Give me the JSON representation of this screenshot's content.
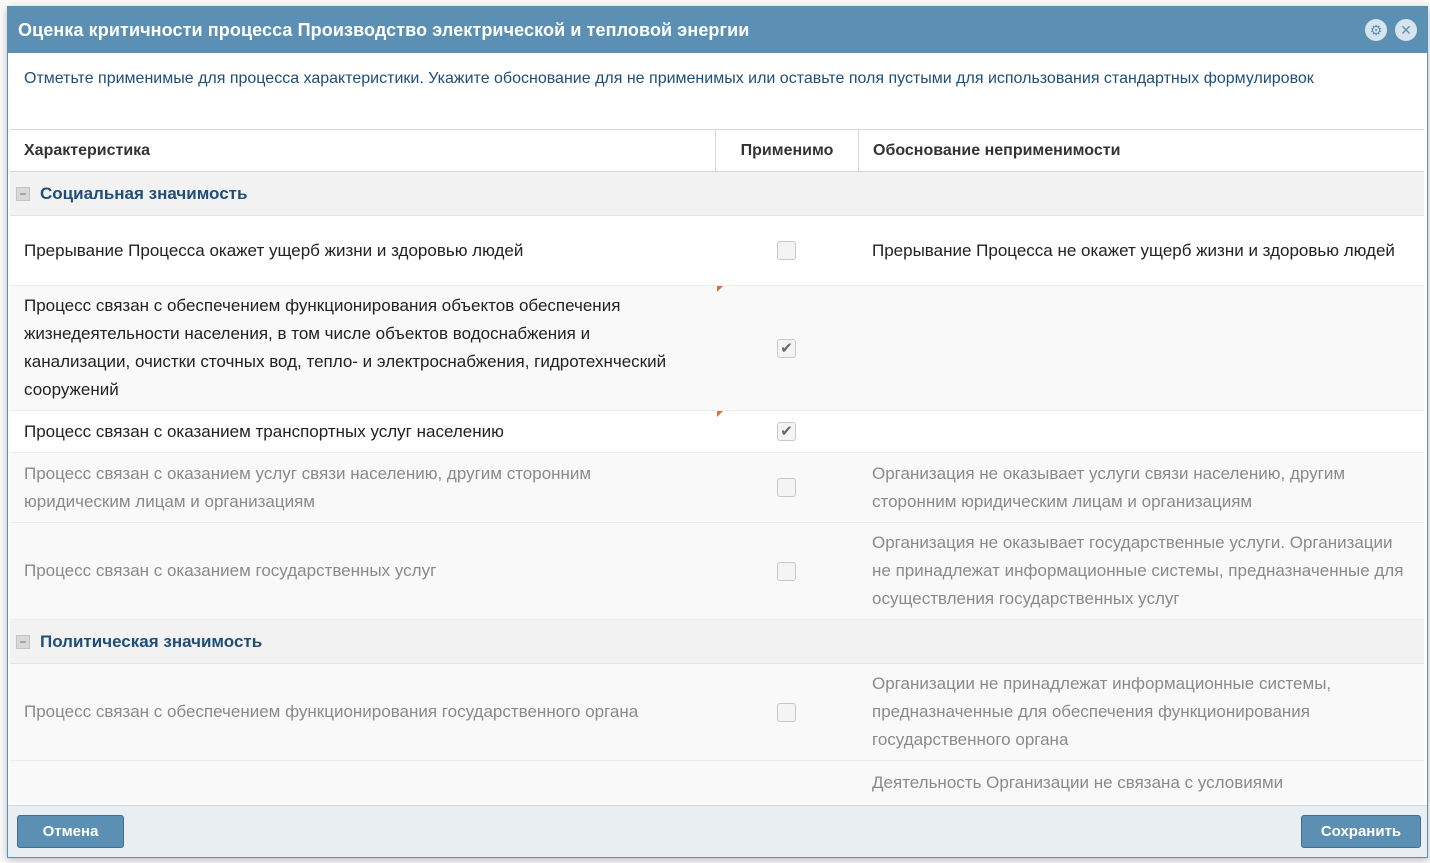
{
  "dialog": {
    "title": "Оценка критичности процесса Производство электрической и тепловой энергии",
    "instructions": "Отметьте применимые для процесса характеристики. Укажите обоснование для не применимых или оставьте поля пустыми для использования стандартных формулировок",
    "icons": [
      "settings-icon",
      "close-icon"
    ]
  },
  "grid": {
    "headers": {
      "characteristic": "Характеристика",
      "applicable": "Применимо",
      "reason": "Обоснование неприменимости"
    },
    "groups": [
      {
        "label": "Социальная значимость",
        "rows": [
          {
            "text": "Прерывание Процесса окажет ущерб жизни и здоровью людей",
            "checked": false,
            "reason": "Прерывание Процесса не окажет ущерб жизни и здоровью людей",
            "disabled": false
          },
          {
            "text": "Процесс связан с обеспечением функционирования объектов обеспечения жизнедеятельности населения, в том числе объектов водоснабжения и канализации, очистки сточных вод, тепло- и электроснабжения, гидротехнческий сооружений",
            "checked": true,
            "reason": "",
            "disabled": false
          },
          {
            "text": "Процесс связан с оказанием транспортных услуг населению",
            "checked": true,
            "reason": "",
            "disabled": false
          },
          {
            "text": "Процесс связан с оказанием услуг связи населению, другим сторонним юридическим лицам и организациям",
            "checked": false,
            "reason": "Организация не оказывает услуги связи населению, другим сторонним юридическим лицам и организациям",
            "disabled": true
          },
          {
            "text": "Процесс связан с оказанием государственных услуг",
            "checked": false,
            "reason": "Организация не оказывает государственные услуги. Организации не принадлежат информационные системы, предназначенные для осуществления государственных услуг",
            "disabled": true
          }
        ]
      },
      {
        "label": "Политическая значимость",
        "rows": [
          {
            "text": "Процесс связан с обеспечением функционирования государственного органа",
            "checked": false,
            "reason": "Организации не принадлежат информационные системы, предназначенные для обеспечения функционирования государственного органа",
            "disabled": true
          },
          {
            "text": "",
            "checked": null,
            "reason": "Деятельность Организации не связана с условиями",
            "disabled": true
          }
        ]
      }
    ],
    "check_mark": "✔",
    "collapse_mark": "−"
  },
  "footer": {
    "cancel_label": "Отмена",
    "save_label": "Сохранить"
  },
  "colors": {
    "titlebar": "#5b90b4",
    "group_text": "#1f4e79",
    "button": "#5b90b4",
    "dirty_marker": "#e0703a"
  }
}
